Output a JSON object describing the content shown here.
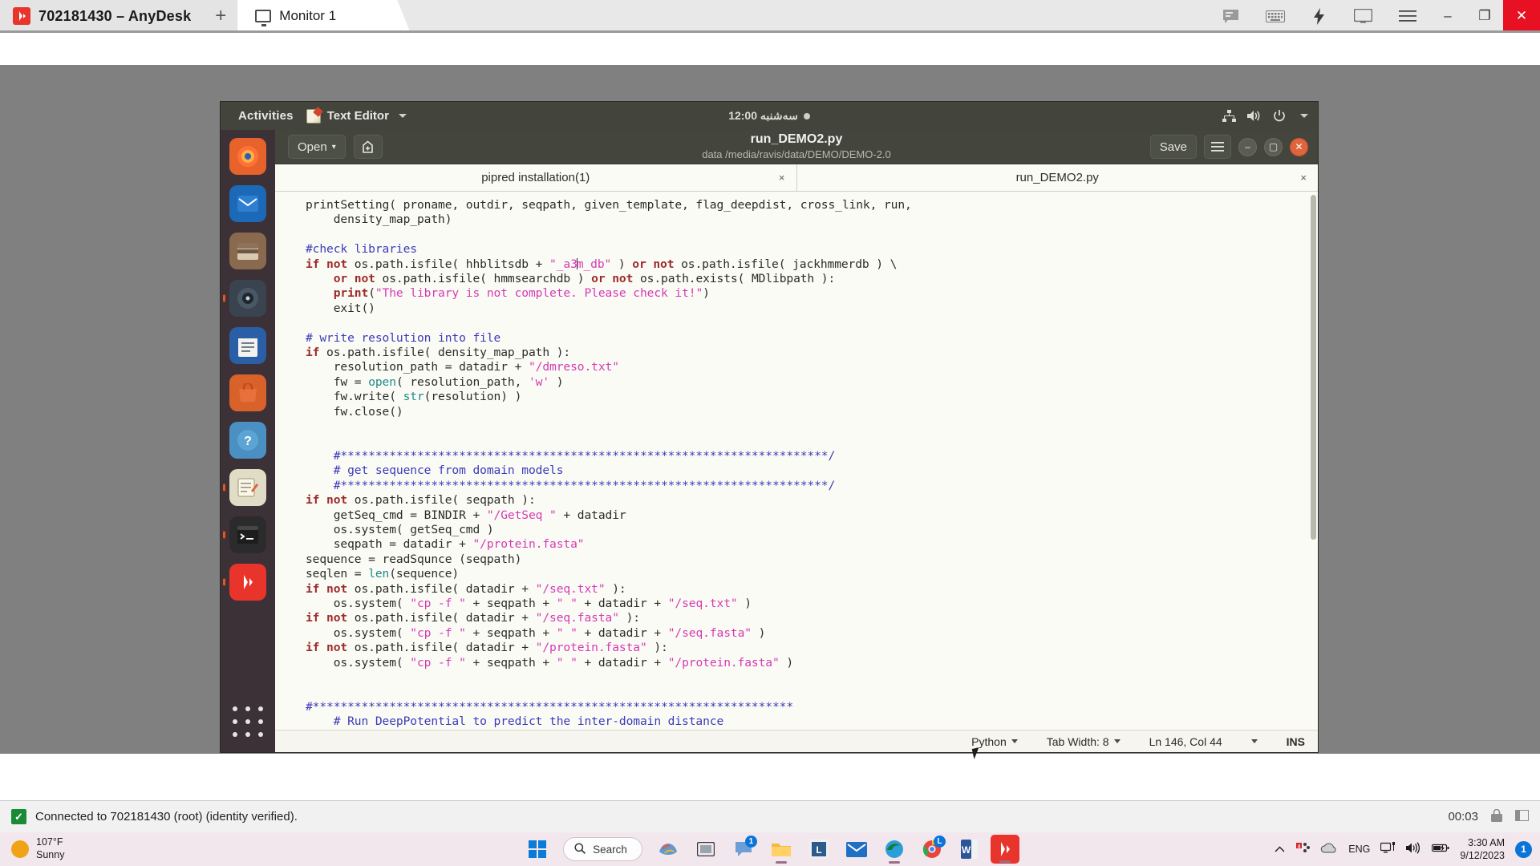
{
  "anydesk": {
    "title": "702181430 – AnyDesk",
    "logo_icon": "anydesk-logo-icon",
    "new_tab_label": "+",
    "tab": {
      "label": "Monitor 1",
      "icon": "monitor-icon"
    },
    "toolbar_icons": [
      "chat-icon",
      "keyboard-icon",
      "bolt-icon",
      "screen-icon",
      "menu-icon"
    ],
    "window_controls": {
      "minimize": "–",
      "maximize": "❐",
      "close": "✕"
    },
    "status": {
      "check_icon": "check-icon",
      "text": "Connected to 702181430 (root) (identity verified).",
      "timer": "00:03",
      "lock_icon": "lock-icon",
      "panel_icon": "panel-icon"
    }
  },
  "gnome": {
    "activities": "Activities",
    "app_name": "Text Editor",
    "app_icon": "text-editor-icon",
    "clock": "سه‌شنبه 12:00",
    "tray_icons": [
      "network-icon",
      "volume-icon",
      "power-icon",
      "chevron-down-icon"
    ]
  },
  "dock": {
    "items": [
      {
        "name": "firefox",
        "glyph": "🦊",
        "color": "#e8622c",
        "running": false
      },
      {
        "name": "thunderbird",
        "glyph": "✉",
        "color": "#2a6fb5",
        "running": false
      },
      {
        "name": "files",
        "glyph": "🗄",
        "color": "#7a5a44",
        "running": false
      },
      {
        "name": "rhythmbox",
        "glyph": "◉",
        "color": "#3d4b57",
        "running": true
      },
      {
        "name": "libreoffice-writer",
        "glyph": "📄",
        "color": "#2a5fa8",
        "running": false
      },
      {
        "name": "ubuntu-software",
        "glyph": "🛍",
        "color": "#d9622b",
        "running": false
      },
      {
        "name": "help",
        "glyph": "?",
        "color": "#4a90c2",
        "running": false
      },
      {
        "name": "text-editor",
        "glyph": "📝",
        "color": "#d8d2bd",
        "running": true
      },
      {
        "name": "terminal",
        "glyph": "❯_",
        "color": "#2b2b2b",
        "running": true
      },
      {
        "name": "anydesk",
        "glyph": "◈",
        "color": "#e8342a",
        "running": true
      }
    ],
    "show_apps_label": "Show Applications"
  },
  "gedit": {
    "open_label": "Open",
    "open_caret": "▾",
    "newdoc_icon": "new-document-icon",
    "title": "run_DEMO2.py",
    "subtitle": "data /media/ravis/data/DEMO/DEMO-2.0",
    "save_label": "Save",
    "menu_icon": "hamburger-menu-icon",
    "window_controls": {
      "minimize": "–",
      "maximize": "▢",
      "close": "✕"
    },
    "tabs": [
      {
        "label": "pipred installation(1)",
        "close": "×"
      },
      {
        "label": "run_DEMO2.py",
        "close": "×"
      }
    ],
    "statusbar": {
      "language": "Python",
      "tab_width": "Tab Width: 8",
      "position": "Ln 146, Col 44",
      "insert_mode": "INS",
      "caret": "▾"
    },
    "code_lines": [
      [
        [
          "",
          "printSetting( proname, outdir, seqpath, given_template, flag_deepdist, cross_link, run,"
        ]
      ],
      [
        [
          "",
          "    density_map_path)"
        ]
      ],
      [
        [
          "",
          ""
        ]
      ],
      [
        [
          "cm",
          "#check libraries"
        ]
      ],
      [
        [
          "kw",
          "if not"
        ],
        [
          "",
          " os.path.isfile( hhblitsdb + "
        ],
        [
          "st",
          "\"_a3"
        ],
        [
          "cursor",
          ""
        ],
        [
          "st",
          "m_db\""
        ],
        [
          "",
          " ) "
        ],
        [
          "kw",
          "or not"
        ],
        [
          "",
          " os.path.isfile( jackhmmerdb ) \\"
        ]
      ],
      [
        [
          "",
          "    "
        ],
        [
          "kw",
          "or not"
        ],
        [
          "",
          " os.path.isfile( hmmsearchdb ) "
        ],
        [
          "kw",
          "or not"
        ],
        [
          "",
          " os.path.exists( MDlibpath ):"
        ]
      ],
      [
        [
          "",
          "    "
        ],
        [
          "kw",
          "print"
        ],
        [
          "",
          "("
        ],
        [
          "st",
          "\"The library is not complete. Please check it!\""
        ],
        [
          "",
          ")"
        ]
      ],
      [
        [
          "",
          "    exit()"
        ]
      ],
      [
        [
          "",
          ""
        ]
      ],
      [
        [
          "cm",
          "# write resolution into file"
        ]
      ],
      [
        [
          "kw",
          "if"
        ],
        [
          "",
          " os.path.isfile( density_map_path ):"
        ]
      ],
      [
        [
          "",
          "    resolution_path = datadir + "
        ],
        [
          "st",
          "\"/dmreso.txt\""
        ]
      ],
      [
        [
          "",
          "    fw = "
        ],
        [
          "bi",
          "open"
        ],
        [
          "",
          "( resolution_path, "
        ],
        [
          "st",
          "'w'"
        ],
        [
          "",
          " )"
        ]
      ],
      [
        [
          "",
          "    fw.write( "
        ],
        [
          "bi",
          "str"
        ],
        [
          "",
          "(resolution) )"
        ]
      ],
      [
        [
          "",
          "    fw.close()"
        ]
      ],
      [
        [
          "",
          ""
        ]
      ],
      [
        [
          "",
          ""
        ]
      ],
      [
        [
          "",
          "    "
        ],
        [
          "cm",
          "#**********************************************************************/"
        ]
      ],
      [
        [
          "",
          "    "
        ],
        [
          "cm",
          "# get sequence from domain models"
        ]
      ],
      [
        [
          "",
          "    "
        ],
        [
          "cm",
          "#**********************************************************************/"
        ]
      ],
      [
        [
          "kw",
          "if not"
        ],
        [
          "",
          " os.path.isfile( seqpath ):"
        ]
      ],
      [
        [
          "",
          "    getSeq_cmd = BINDIR + "
        ],
        [
          "st",
          "\"/GetSeq \""
        ],
        [
          "",
          " + datadir"
        ]
      ],
      [
        [
          "",
          "    os.system( getSeq_cmd )"
        ]
      ],
      [
        [
          "",
          "    seqpath = datadir + "
        ],
        [
          "st",
          "\"/protein.fasta\""
        ]
      ],
      [
        [
          "",
          "sequence = readSqunce (seqpath)"
        ]
      ],
      [
        [
          "",
          "seqlen = "
        ],
        [
          "bi",
          "len"
        ],
        [
          "",
          "(sequence)"
        ]
      ],
      [
        [
          "kw",
          "if not"
        ],
        [
          "",
          " os.path.isfile( datadir + "
        ],
        [
          "st",
          "\"/seq.txt\""
        ],
        [
          "",
          " ):"
        ]
      ],
      [
        [
          "",
          "    os.system( "
        ],
        [
          "st",
          "\"cp -f \""
        ],
        [
          "",
          " + seqpath + "
        ],
        [
          "st",
          "\" \""
        ],
        [
          "",
          " + datadir + "
        ],
        [
          "st",
          "\"/seq.txt\""
        ],
        [
          "",
          " )"
        ]
      ],
      [
        [
          "kw",
          "if not"
        ],
        [
          "",
          " os.path.isfile( datadir + "
        ],
        [
          "st",
          "\"/seq.fasta\""
        ],
        [
          "",
          " ):"
        ]
      ],
      [
        [
          "",
          "    os.system( "
        ],
        [
          "st",
          "\"cp -f \""
        ],
        [
          "",
          " + seqpath + "
        ],
        [
          "st",
          "\" \""
        ],
        [
          "",
          " + datadir + "
        ],
        [
          "st",
          "\"/seq.fasta\""
        ],
        [
          "",
          " )"
        ]
      ],
      [
        [
          "kw",
          "if not"
        ],
        [
          "",
          " os.path.isfile( datadir + "
        ],
        [
          "st",
          "\"/protein.fasta\""
        ],
        [
          "",
          " ):"
        ]
      ],
      [
        [
          "",
          "    os.system( "
        ],
        [
          "st",
          "\"cp -f \""
        ],
        [
          "",
          " + seqpath + "
        ],
        [
          "st",
          "\" \""
        ],
        [
          "",
          " + datadir + "
        ],
        [
          "st",
          "\"/protein.fasta\""
        ],
        [
          "",
          " )"
        ]
      ],
      [
        [
          "",
          ""
        ]
      ],
      [
        [
          "",
          ""
        ]
      ],
      [
        [
          "cm",
          "#*********************************************************************"
        ]
      ],
      [
        [
          "",
          "    "
        ],
        [
          "cm",
          "# Run DeepPotential to predict the inter-domain distance"
        ]
      ]
    ]
  },
  "taskbar": {
    "weather": {
      "temp": "107°F",
      "condition": "Sunny",
      "icon": "sun-icon"
    },
    "start_icon": "windows-start-icon",
    "search_placeholder": "Search",
    "search_icon": "search-icon",
    "items": [
      {
        "name": "copilot-icon",
        "badge": ""
      },
      {
        "name": "task-view-icon",
        "badge": ""
      },
      {
        "name": "chat-teams-icon",
        "badge": "1"
      },
      {
        "name": "file-explorer-icon",
        "badge": ""
      },
      {
        "name": "app-icon",
        "badge": ""
      },
      {
        "name": "mail-icon",
        "badge": ""
      },
      {
        "name": "edge-icon",
        "badge": ""
      },
      {
        "name": "chrome-icon",
        "badge": "L"
      },
      {
        "name": "word-icon",
        "badge": ""
      },
      {
        "name": "anydesk-taskbar-icon",
        "badge": ""
      }
    ],
    "tray": {
      "chevron": "⌃",
      "icons": [
        "apps-tray-icon",
        "onedrive-icon",
        "network-icon",
        "volume-icon",
        "battery-icon"
      ],
      "language": "ENG",
      "time": "3:30 AM",
      "date": "9/12/2023",
      "notification_count": "1"
    }
  }
}
